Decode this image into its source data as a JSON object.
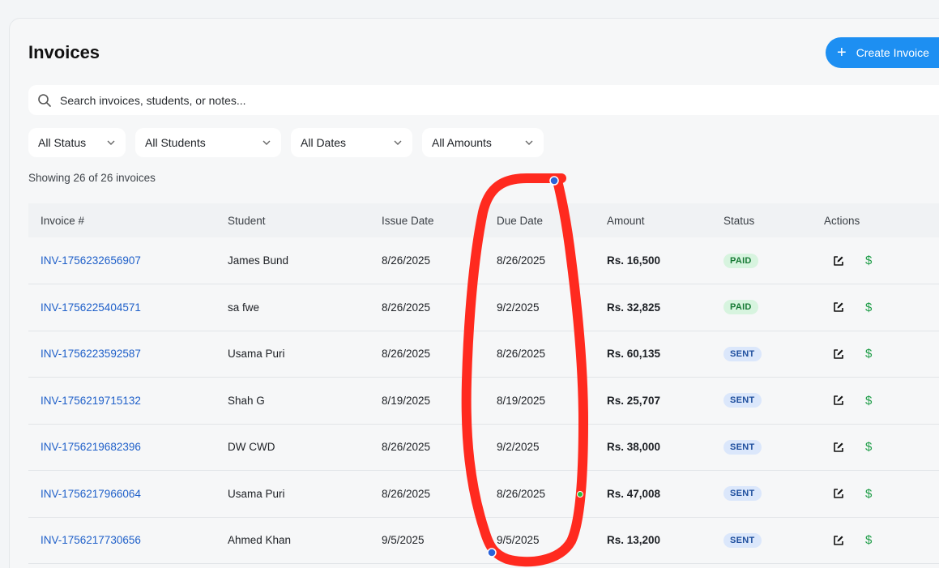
{
  "header": {
    "title": "Invoices",
    "create_label": "Create Invoice"
  },
  "search": {
    "placeholder": "Search invoices, students, or notes..."
  },
  "filters": [
    {
      "label": "All Status"
    },
    {
      "label": "All Students"
    },
    {
      "label": "All Dates"
    },
    {
      "label": "All Amounts"
    }
  ],
  "summary": {
    "count_text": "Showing 26 of 26 invoices"
  },
  "table": {
    "columns": [
      "Invoice #",
      "Student",
      "Issue Date",
      "Due Date",
      "Amount",
      "Status",
      "Actions"
    ],
    "rows": [
      {
        "invoice": "INV-1756232656907",
        "student": "James Bund",
        "issue": "8/26/2025",
        "due": "8/26/2025",
        "amount": "Rs. 16,500",
        "status": "PAID"
      },
      {
        "invoice": "INV-1756225404571",
        "student": "sa fwe",
        "issue": "8/26/2025",
        "due": "9/2/2025",
        "amount": "Rs. 32,825",
        "status": "PAID"
      },
      {
        "invoice": "INV-1756223592587",
        "student": "Usama Puri",
        "issue": "8/26/2025",
        "due": "8/26/2025",
        "amount": "Rs. 60,135",
        "status": "SENT"
      },
      {
        "invoice": "INV-1756219715132",
        "student": "Shah G",
        "issue": "8/19/2025",
        "due": "8/19/2025",
        "amount": "Rs. 25,707",
        "status": "SENT"
      },
      {
        "invoice": "INV-1756219682396",
        "student": "DW CWD",
        "issue": "8/26/2025",
        "due": "9/2/2025",
        "amount": "Rs. 38,000",
        "status": "SENT"
      },
      {
        "invoice": "INV-1756217966064",
        "student": "Usama Puri",
        "issue": "8/26/2025",
        "due": "8/26/2025",
        "amount": "Rs. 47,008",
        "status": "SENT"
      },
      {
        "invoice": "INV-1756217730656",
        "student": "Ahmed Khan",
        "issue": "9/5/2025",
        "due": "9/5/2025",
        "amount": "Rs. 13,200",
        "status": "SENT"
      }
    ]
  },
  "icons": {
    "search": "search-icon",
    "chevron": "chevron-down-icon",
    "edit": "edit-icon",
    "pay": "dollar-icon",
    "plus": "plus-icon"
  },
  "colors": {
    "accent": "#1d8ff2",
    "link": "#1e5fc9",
    "paid_bg": "#d7f4df",
    "sent_bg": "#dbe7fb",
    "annotation": "#ff2a1f",
    "money": "#1f9d48"
  }
}
